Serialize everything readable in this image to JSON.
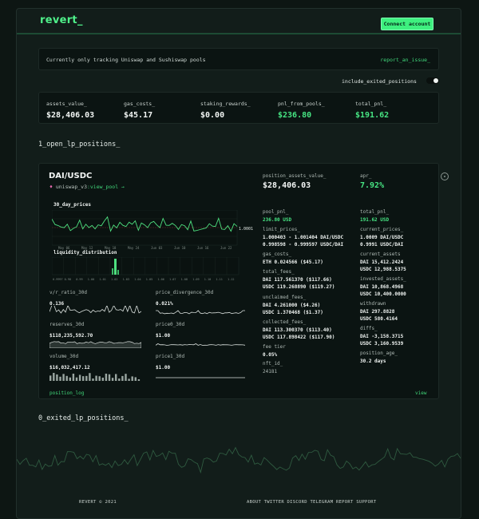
{
  "header": {
    "logo": "revert_",
    "connect_label": "Connect account"
  },
  "notice": {
    "text": "Currently only tracking Uniswap and Sushiswap pools",
    "link": "report_an_issue_"
  },
  "toggle": {
    "label": "include_exited_positions",
    "on": false
  },
  "summary": [
    {
      "label": "assets_value_",
      "value": "$28,406.03",
      "color": "white"
    },
    {
      "label": "gas_costs_",
      "value": "$45.17",
      "color": "white"
    },
    {
      "label": "staking_rewards_",
      "value": "$0.00",
      "color": "white"
    },
    {
      "label": "pnl_from_pools_",
      "value": "$236.80",
      "color": "green"
    },
    {
      "label": "total_pnl_",
      "value": "$191.62",
      "color": "green"
    }
  ],
  "open_section": "1_open_lp_positions_",
  "exited_section": "0_exited_lp_positions_",
  "position": {
    "pair": "DAI/USDC",
    "protocol": "uniswap_v3",
    "view_pool": ":view_pool →",
    "assets_label": "position_assets_value_",
    "assets_value": "$28,406.03",
    "apr_label": "apr_",
    "apr_value": "7.92%",
    "chart_title": "30_day_prices",
    "chart_current": "1.0001",
    "chart_x_ticks": [
      "May 06",
      "May 12",
      "May 18",
      "May 24",
      "Jun 03",
      "Jun 10",
      "Jun 16",
      "Jun 22"
    ],
    "liquidity_title": "liquidity_distribution",
    "liquidity_ticks": [
      "0.9997",
      "0.98",
      "0.99",
      "1.00",
      "1.01",
      "1.02",
      "1.03",
      "1.04",
      "1.05",
      "1.06",
      "1.07",
      "1.08",
      "1.09",
      "1.10",
      "1.11",
      "1.12"
    ],
    "mini": [
      {
        "label": "v/r_ratio_30d",
        "value": "0.136"
      },
      {
        "label": "price_divergence_30d",
        "value": "0.021%"
      },
      {
        "label": "reserves_30d",
        "value": "$118,235,592.70"
      },
      {
        "label": "price0_30d",
        "value": "$1.00"
      },
      {
        "label": "volume_30d",
        "value": "$16,032,417.12"
      },
      {
        "label": "price1_30d",
        "value": "$1.00"
      }
    ],
    "col1": {
      "pool_pnl_label": "pool_pnl_",
      "pool_pnl_value": "236.80 USD",
      "limit_prices_label": "limit_prices_",
      "limit_prices_1": "1.000403 - 1.001404 DAI/USDC",
      "limit_prices_2": "0.998598 - 0.999597 USDC/DAI",
      "gas_label": "gas_costs_",
      "gas_value": "ETH 0.024566 ($45.17)",
      "total_fees_label": "total_fees_",
      "total_fees_1": "DAI 117.561370 ($117.66)",
      "total_fees_2": "USDC 119.268890 ($119.27)",
      "unclaimed_label": "unclaimed_fees_",
      "unclaimed_1": "DAI 4.261000 ($4.26)",
      "unclaimed_2": "USDC 1.370468 ($1.37)",
      "collected_label": "collected_fees_",
      "collected_1": "DAI 113.300370 ($113.40)",
      "collected_2": "USDC 117.898422 ($117.90)",
      "fee_tier_label": "fee tier",
      "fee_tier_value": "0.05%",
      "nft_label": "nft_id_",
      "nft_value": "24181"
    },
    "col2": {
      "total_pnl_label": "total_pnl_",
      "total_pnl_value": "191.62 USD",
      "current_prices_label": "current_prices_",
      "current_prices_1": "1.0009 DAI/USDC",
      "current_prices_2": "0.9991 USDC/DAI",
      "current_assets_label": "current_assets",
      "current_assets_1": "DAI 15,412.2424",
      "current_assets_2": "USDC 12,988.5375",
      "invested_label": "invested_assets_",
      "invested_1": "DAI 10,868.4968",
      "invested_2": "USDC 10,400.0000",
      "withdrawn_label": "withdrawn",
      "withdrawn_1": "DAI 297.8828",
      "withdrawn_2": "USDC 580.4164",
      "diffs_label": "diffs_",
      "diffs_1": "DAI -3,158.3715",
      "diffs_2": "USDC 3,160.9539",
      "age_label": "position_age_",
      "age_value": "30.2 days"
    },
    "log_link": "position_log",
    "view_link": "view"
  },
  "footer": {
    "left": "REVERT © 2021",
    "links": "ABOUT TWITTER DISCORD TELEGRAM REPORT SUPPORT"
  },
  "colors": {
    "accent": "#3ef07f",
    "bg": "#0d1613",
    "card": "#0b1412"
  }
}
